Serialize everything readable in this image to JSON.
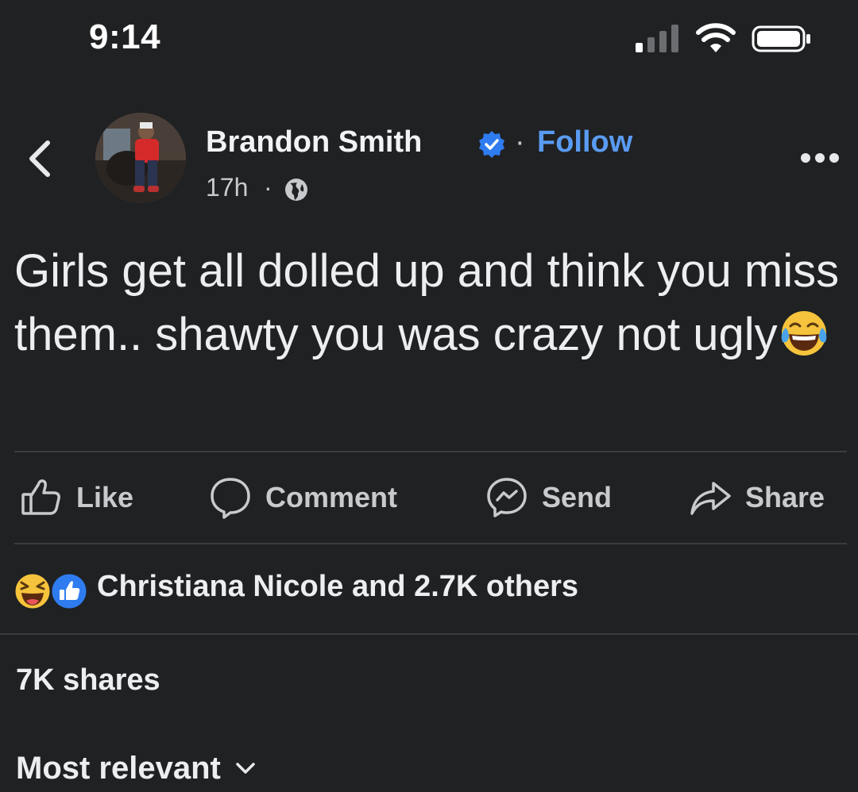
{
  "status_bar": {
    "time": "9:14",
    "signal_icon": "cellular-signal-icon",
    "wifi_icon": "wifi-icon",
    "battery_icon": "battery-icon"
  },
  "post_header": {
    "author_name": "Brandon Smith",
    "verified_icon": "verified-badge-icon",
    "separator": "·",
    "follow_label": "Follow",
    "time_ago": "17h",
    "meta_separator": "·",
    "audience_icon": "globe-icon",
    "accent_color": "#5a9bf2"
  },
  "post": {
    "text": "Girls get all dolled up and think you miss them.. shawty you was crazy not ugly",
    "trailing_emoji": "tears-of-joy-emoji"
  },
  "actions": {
    "like_label": "Like",
    "comment_label": "Comment",
    "send_label": "Send",
    "share_label": "Share"
  },
  "reactions": {
    "icons": [
      "haha-reaction-icon",
      "like-reaction-icon"
    ],
    "summary": "Christiana Nicole and 2.7K others"
  },
  "shares": "7K shares",
  "comments_sort": {
    "label": "Most relevant"
  }
}
